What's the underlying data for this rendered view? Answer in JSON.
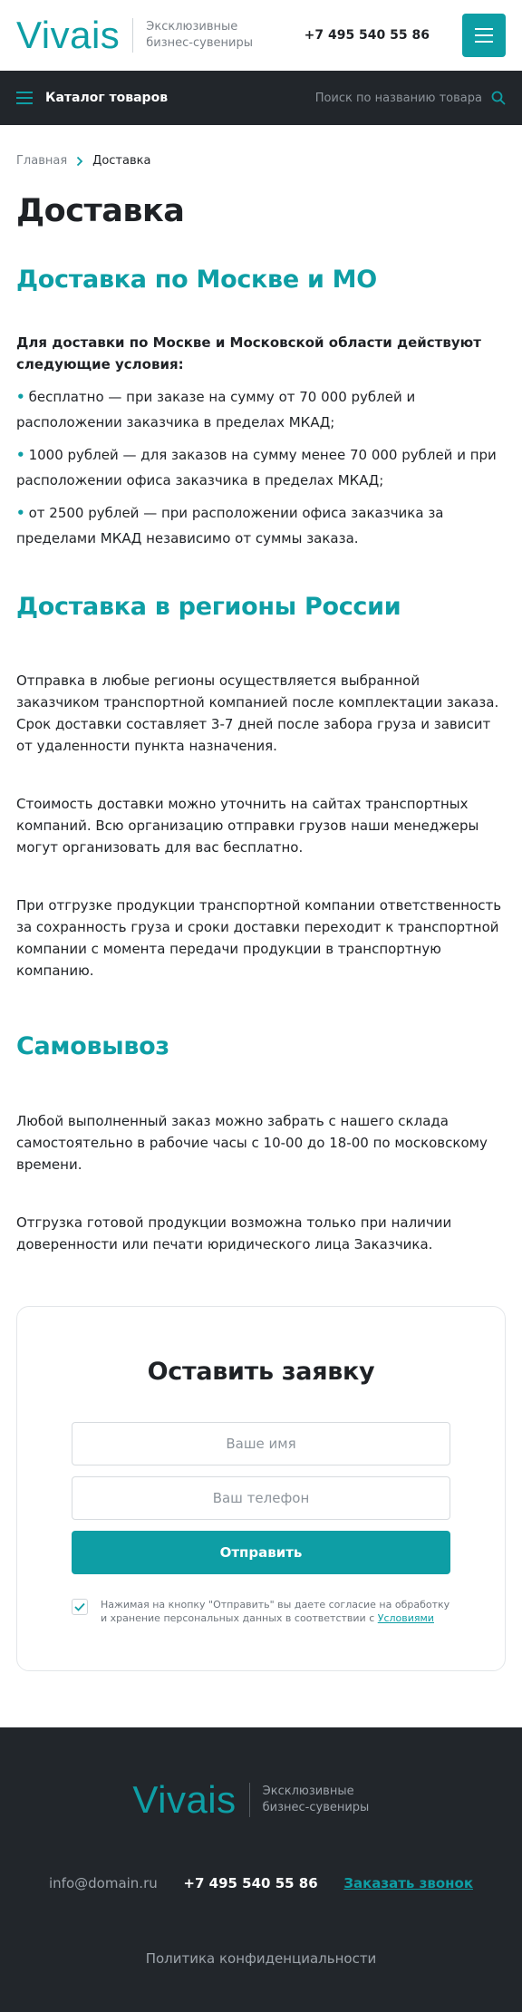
{
  "header": {
    "logo": "Vivais",
    "tagline": "Эксклюзивные бизнес-сувениры",
    "phone": "+7 495 540 55 86",
    "menu_icon": "hamburger-icon"
  },
  "catalog_bar": {
    "label": "Каталог товаров",
    "search_placeholder": "Поиск по названию товара",
    "search_icon": "search-icon"
  },
  "breadcrumb": {
    "home": "Главная",
    "current": "Доставка"
  },
  "page": {
    "title": "Доставка",
    "section1": {
      "title": "Доставка по Москве и МО",
      "lead": "Для доставки по Москве и Московской области действуют следующие условия:",
      "items": [
        "бесплатно — при заказе на сумму от 70 000 рублей и расположении заказчика в пределах МКАД;",
        "1000 рублей — для заказов на сумму менее 70 000 рублей и при расположении офиса заказчика в пределах МКАД;",
        "от 2500 рублей — при расположении офиса заказчика за пределами МКАД независимо от суммы заказа."
      ]
    },
    "section2": {
      "title": "Доставка в регионы России",
      "paragraphs": [
        "Отправка в любые регионы осуществляется выбранной заказчиком транспортной компанией после комплектации заказа. Срок доставки составляет 3-7 дней после забора груза и зависит от удаленности пункта назначения.",
        "Стоимость доставки можно уточнить на сайтах транспортных компаний. Всю организацию отправки грузов наши менеджеры могут организовать для вас бесплатно.",
        "При отгрузке продукции транспортной компании ответственность за сохранность груза и сроки доставки переходит к транспортной компании с момента передачи продукции в транспортную компанию."
      ]
    },
    "section3": {
      "title": "Самовывоз",
      "paragraphs": [
        "Любой выполненный заказ можно забрать с нашего склада самостоятельно в рабочие часы с 10-00 до 18-00 по московскому времени.",
        "Отгрузка готовой продукции возможна только при наличии доверенности или печати юридического лица Заказчика."
      ]
    }
  },
  "form": {
    "title": "Оставить заявку",
    "name_placeholder": "Ваше имя",
    "phone_placeholder": "Ваш телефон",
    "submit_label": "Отправить",
    "consent_checked": true,
    "consent_text": "Нажимая на кнопку \"Отправить\" вы даете согласие на обработку и хранение персональных данных в соответствии с",
    "consent_link": "Условиями"
  },
  "footer": {
    "logo": "Vivais",
    "tagline": "Эксклюзивные бизнес-сувениры",
    "email": "info@domain.ru",
    "phone": "+7 495 540 55 86",
    "callback": "Заказать звонок",
    "policy": "Политика конфиденциальности"
  },
  "colors": {
    "accent": "#0e9ea5",
    "dark": "#22262b",
    "text": "#1f2226",
    "muted": "#7a8087"
  }
}
